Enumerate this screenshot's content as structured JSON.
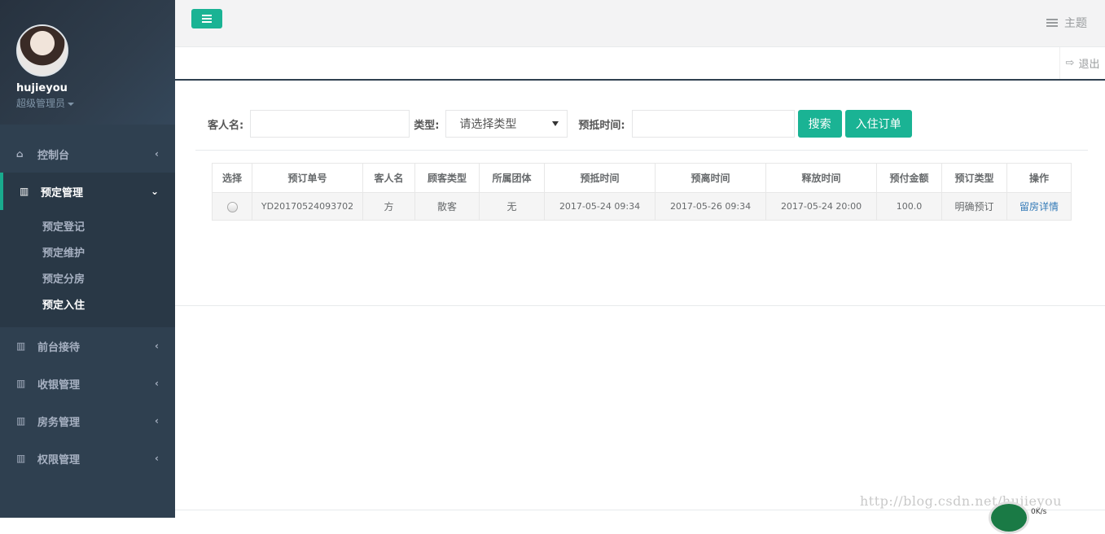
{
  "user": {
    "name": "hujieyou",
    "role": "超级管理员"
  },
  "nav": {
    "dashboard": "控制台",
    "booking": "预定管理",
    "booking_sub": [
      "预定登记",
      "预定维护",
      "预定分房",
      "预定入住"
    ],
    "frontdesk": "前台接待",
    "cashier": "收银管理",
    "housekeeping": "房务管理",
    "permissions": "权限管理"
  },
  "topbar": {
    "theme": "主题",
    "logout": "退出"
  },
  "search": {
    "guest_label": "客人名:",
    "guest_value": "",
    "type_label": "类型:",
    "type_selected": "请选择类型",
    "time_label": "预抵时间:",
    "time_value": "",
    "search_btn": "搜索",
    "checkin_btn": "入住订单"
  },
  "table": {
    "headers": [
      "选择",
      "预订单号",
      "客人名",
      "顾客类型",
      "所属团体",
      "预抵时间",
      "预离时间",
      "释放时间",
      "预付金额",
      "预订类型",
      "操作"
    ],
    "rows": [
      {
        "order_no": "YD20170524093702",
        "guest": "方",
        "customer_type": "散客",
        "group": "无",
        "arrive": "2017-05-24 09:34",
        "depart": "2017-05-26 09:34",
        "release": "2017-05-24 20:00",
        "deposit": "100.0",
        "booking_type": "明确预订",
        "action": "留房详情"
      }
    ]
  },
  "watermark": "http://blog.csdn.net/hujieyou",
  "net_speed": "0K/s"
}
